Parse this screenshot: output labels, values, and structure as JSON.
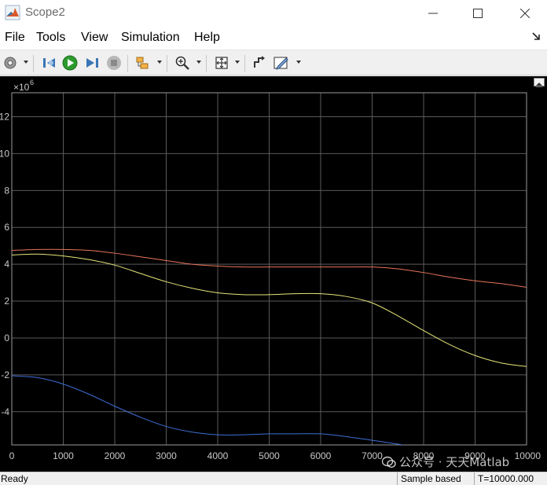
{
  "window": {
    "title": "Scope2",
    "icon": "matlab-logo-icon"
  },
  "menu": [
    "File",
    "Tools",
    "View",
    "Simulation",
    "Help"
  ],
  "toolbar": {
    "icons": [
      "settings-gear-icon",
      "step-back-icon",
      "run-icon",
      "step-forward-icon",
      "stop-icon",
      "signal-trigger-icon",
      "zoom-icon",
      "autoscale-icon",
      "highlight-block-icon",
      "style-edit-icon"
    ]
  },
  "axes": {
    "exponent_base": "×10",
    "exponent_power": "6",
    "grid": true,
    "background": "#000000",
    "grid_color": "#5a5a5a",
    "tick_color": "#c8c8c8"
  },
  "chart_data": {
    "type": "line",
    "xlim": [
      0,
      10000
    ],
    "ylim": [
      -5.8,
      13.3
    ],
    "y_scale_exponent": 6,
    "x_ticks": [
      0,
      1000,
      2000,
      3000,
      4000,
      5000,
      6000,
      7000,
      8000,
      9000,
      10000
    ],
    "x_tick_labels": [
      "0",
      "1000",
      "2000",
      "3000",
      "4000",
      "5000",
      "6000",
      "7000",
      "8000",
      "9000",
      "10000"
    ],
    "y_ticks": [
      -4,
      -2,
      0,
      2,
      4,
      6,
      8,
      10,
      12
    ],
    "y_tick_labels": [
      "-4",
      "-2",
      "0",
      "2",
      "4",
      "6",
      "8",
      "10",
      "12"
    ],
    "series": [
      {
        "color": "#e8745a",
        "x": [
          0,
          500,
          1000,
          1500,
          2000,
          2500,
          3000,
          3500,
          4000,
          4500,
          5000,
          5500,
          6000,
          6500,
          7000,
          7500,
          8000,
          8500,
          9000,
          9500,
          10000
        ],
        "y": [
          4.75,
          4.8,
          4.8,
          4.75,
          4.6,
          4.4,
          4.2,
          4.0,
          3.9,
          3.85,
          3.85,
          3.85,
          3.85,
          3.85,
          3.85,
          3.75,
          3.55,
          3.3,
          3.1,
          2.95,
          2.75
        ]
      },
      {
        "color": "#e6e67a",
        "x": [
          0,
          500,
          1000,
          1500,
          2000,
          2500,
          3000,
          3500,
          4000,
          4500,
          5000,
          5500,
          6000,
          6500,
          7000,
          7500,
          8000,
          8500,
          9000,
          9500,
          10000
        ],
        "y": [
          4.5,
          4.55,
          4.45,
          4.25,
          3.95,
          3.5,
          3.05,
          2.7,
          2.45,
          2.35,
          2.35,
          2.4,
          2.4,
          2.25,
          1.9,
          1.2,
          0.4,
          -0.35,
          -0.95,
          -1.35,
          -1.55
        ]
      },
      {
        "color": "#3e6fd8",
        "x": [
          0,
          500,
          1000,
          1500,
          2000,
          2500,
          3000,
          3500,
          4000,
          4500,
          5000,
          5500,
          6000,
          6500,
          7000,
          7600
        ],
        "y": [
          -2.05,
          -2.15,
          -2.5,
          -3.05,
          -3.7,
          -4.3,
          -4.8,
          -5.1,
          -5.25,
          -5.25,
          -5.2,
          -5.2,
          -5.2,
          -5.35,
          -5.55,
          -5.8
        ]
      }
    ]
  },
  "status": {
    "state": "Ready",
    "mode": "Sample based",
    "time": "T=10000.000"
  },
  "watermark": "公众号 · 天天Matlab"
}
